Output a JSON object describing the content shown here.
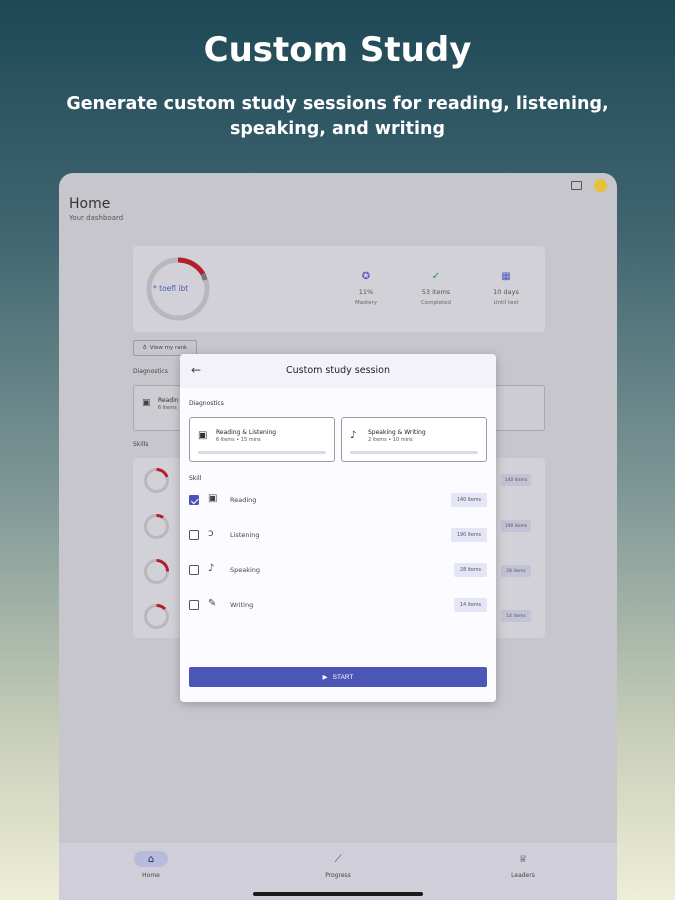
{
  "promo": {
    "headline": "Custom Study",
    "subline": "Generate custom study sessions for reading, listening, speaking, and writing"
  },
  "app": {
    "page_title": "Home",
    "page_subtitle": "Your dashboard",
    "score_logo": "* toefl ibt",
    "stats": [
      {
        "icon": "mastery-icon",
        "value": "11%",
        "label": "Mastery"
      },
      {
        "icon": "completed-check-icon",
        "value": "53 items",
        "label": "Completed"
      },
      {
        "icon": "calendar-icon",
        "value": "10 days",
        "label": "Until test"
      }
    ],
    "plan_button_label": "View my rank",
    "diagnostics_label": "Diagnostics",
    "skills_label": "Skills",
    "bg_diag_text": "Readin",
    "bg_diag_meta": "6 items",
    "bg_tags": [
      "140 items",
      "190 items",
      "28 items",
      "14 items"
    ]
  },
  "modal": {
    "title": "Custom study session",
    "diagnostics_label": "Diagnostics",
    "diagnostics": [
      {
        "title": "Reading & Listening",
        "meta": "6 items • 15 mins",
        "icon": "reading-listening-icon"
      },
      {
        "title": "Speaking & Writing",
        "meta": "2 items • 10 mins",
        "icon": "mic-icon"
      }
    ],
    "skill_label": "Skill",
    "skills": [
      {
        "name": "Reading",
        "count": "140 items",
        "checked": true,
        "icon": "book-icon"
      },
      {
        "name": "Listening",
        "count": "190 items",
        "checked": false,
        "icon": "ear-icon"
      },
      {
        "name": "Speaking",
        "count": "28 items",
        "checked": false,
        "icon": "mic-icon"
      },
      {
        "name": "Writing",
        "count": "14 items",
        "checked": false,
        "icon": "pencil-icon"
      }
    ],
    "start_label": "START"
  },
  "nav": {
    "items": [
      {
        "label": "Home",
        "icon": "home-icon",
        "active": true
      },
      {
        "label": "Progress",
        "icon": "progress-icon",
        "active": false
      },
      {
        "label": "Leaders",
        "icon": "trophy-icon",
        "active": false
      }
    ]
  },
  "colors": {
    "accent": "#4c56b6",
    "ring_progress": "#b3202c"
  }
}
